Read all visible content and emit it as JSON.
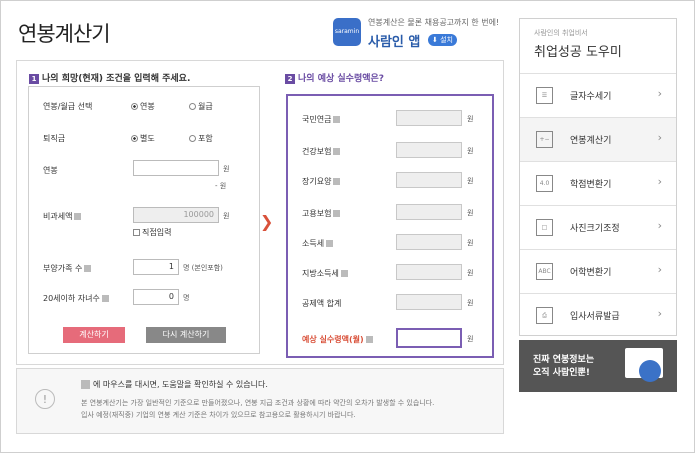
{
  "header": {
    "title": "연봉계산기",
    "promo_text": "연봉계산은 물론 채용공고까지 한 번에!",
    "promo_app": "사람인 앱",
    "promo_btn": "설치",
    "logo_text": "saramin"
  },
  "left": {
    "section_title": "나의 희망(현재) 조건을 입력해 주세요.",
    "section_num": "1",
    "salary_type_label": "연봉/월급 선택",
    "salary_type_options": [
      "연봉",
      "월급"
    ],
    "salary_type_selected": "연봉",
    "severance_label": "퇴직금",
    "severance_options": [
      "별도",
      "포함"
    ],
    "severance_selected": "별도",
    "salary_label": "연봉",
    "salary_value": "",
    "salary_unit": "원",
    "salary_sub": "- 원",
    "nontax_label": "비과세액",
    "nontax_value": "100000",
    "nontax_unit": "원",
    "nontax_direct": "직접입력",
    "dependents_label": "부양가족 수",
    "dependents_value": "1",
    "dependents_unit": "명 (본인포함)",
    "children_label": "20세이하 자녀수",
    "children_value": "0",
    "children_unit": "명",
    "calc_btn": "계산하기",
    "reset_btn": "다시 계산하기"
  },
  "right": {
    "section_title": "나의 예상 실수령액은?",
    "section_num": "2",
    "rows": [
      {
        "label": "국민연금",
        "unit": "원"
      },
      {
        "label": "건강보험",
        "unit": "원"
      },
      {
        "label": "장기요양",
        "unit": "원"
      },
      {
        "label": "고용보험",
        "unit": "원"
      },
      {
        "label": "소득세",
        "unit": "원"
      },
      {
        "label": "지방소득세",
        "unit": "원"
      },
      {
        "label": "공제액 합계",
        "unit": "원"
      }
    ],
    "net_label": "예상 실수령액(월)",
    "net_unit": "원"
  },
  "notice": {
    "head": "에 마우스를 대시면, 도움말을 확인하실 수 있습니다.",
    "line1": "본 연봉계산기는 가장 일반적인 기준으로 만들어졌으나, 연봉 지급 조건과 상황에 따라 약간의 오차가 발생할 수 있습니다.",
    "line2": "입사 예정(재직중) 기업의 연봉 계산 기준은 차이가 있으므로 참고용으로 활용하시기 바랍니다."
  },
  "sidebar": {
    "sub": "사람인의 취업비서",
    "title": "취업성공 도우미",
    "items": [
      {
        "label": "글자수세기",
        "icon": "doc-icon"
      },
      {
        "label": "연봉계산기",
        "icon": "calculator-icon"
      },
      {
        "label": "학점변환기",
        "icon": "grade-icon"
      },
      {
        "label": "사진크기조정",
        "icon": "crop-icon"
      },
      {
        "label": "어학변환기",
        "icon": "language-icon"
      },
      {
        "label": "입사서류발급",
        "icon": "printer-icon"
      }
    ],
    "active_index": 1
  },
  "banner": {
    "line1": "진짜 연봉정보는",
    "line2": "오직 사람인뿐!"
  }
}
